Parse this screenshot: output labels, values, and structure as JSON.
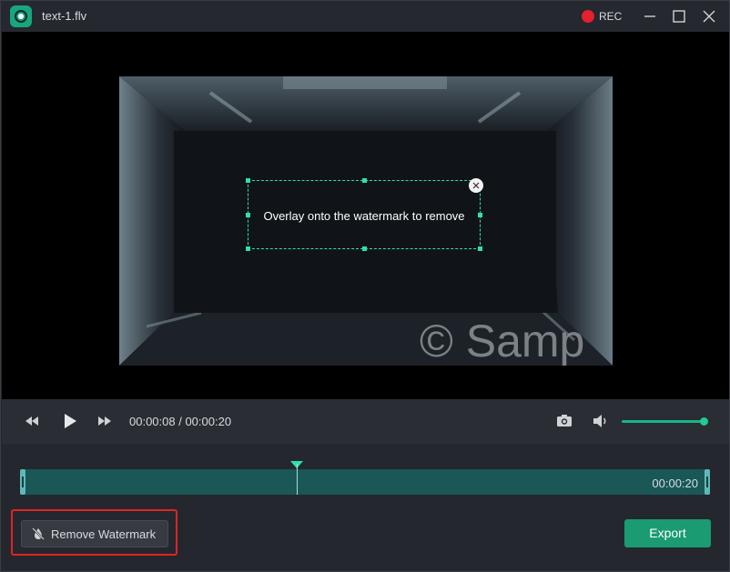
{
  "window": {
    "title": "text-1.flv",
    "rec_label": "REC"
  },
  "video": {
    "overlay_hint": "Overlay onto the watermark to remove",
    "watermark_text": "© Samp"
  },
  "player": {
    "current_time": "00:00:08",
    "total_time": "00:00:20",
    "time_separator": " / ",
    "volume_level": 0.95
  },
  "timeline": {
    "end_time": "00:00:20",
    "playhead_fraction": 0.4
  },
  "actions": {
    "remove_watermark_label": "Remove Watermark",
    "export_label": "Export"
  },
  "icons": {
    "app": "app-logo-icon",
    "rec": "record-dot-icon",
    "minimize": "minimize-icon",
    "maximize": "maximize-icon",
    "close": "close-icon",
    "rewind": "rewind-icon",
    "play": "play-icon",
    "forward": "fast-forward-icon",
    "snapshot": "camera-icon",
    "volume": "volume-icon",
    "remove_watermark": "watermark-off-icon"
  },
  "colors": {
    "accent": "#1a9b72",
    "selection": "#2ee0ac",
    "timeline": "#1a5757",
    "rec": "#e5202f",
    "highlight": "#e02424"
  }
}
